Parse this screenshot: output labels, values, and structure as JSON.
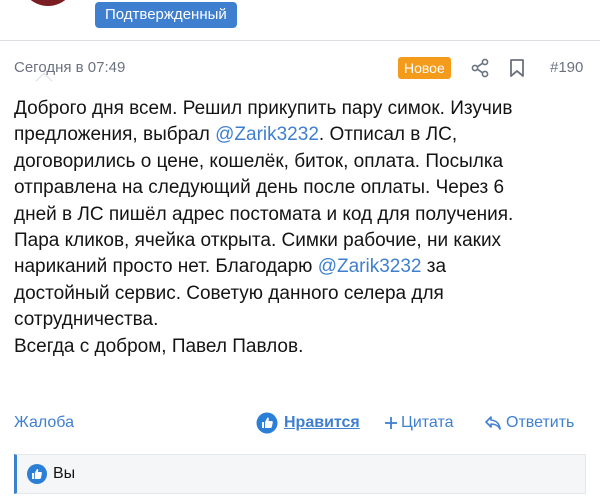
{
  "header": {
    "badge": "Подтвержденный"
  },
  "post": {
    "date": "Сегодня в 07:49",
    "new_label": "Новое",
    "number": "#190",
    "lines": [
      [
        "Доброго дня всем. Решил прикупить пару симок. Изучив"
      ],
      [
        "предложения, выбрал ",
        "@Zarik3232",
        ". Отписал в ЛС,"
      ],
      [
        "договорились о цене, кошелёк, биток, оплата. Посылка"
      ],
      [
        "отправлена на следующий день после оплаты. Через 6"
      ],
      [
        "дней в ЛС пишёл адрес постомата и код для получения."
      ],
      [
        "Пара кликов, ячейка открыта. Симки рабочие, ни каких"
      ],
      [
        "нариканий просто нет. Благодарю ",
        "@Zarik3232",
        " за"
      ],
      [
        "достойный сервис. Советую данного селера для"
      ],
      [
        "сотрудничества."
      ],
      [
        "Всегда с добром, Павел Павлов."
      ]
    ]
  },
  "actions": {
    "report": "Жалоба",
    "like": "Нравится",
    "quote": "Цитата",
    "reply": "Ответить"
  },
  "reactions": {
    "text": "Вы"
  },
  "colors": {
    "accent": "#3f7fd0",
    "new_badge": "#f59b1c",
    "muted": "#6b7380"
  }
}
